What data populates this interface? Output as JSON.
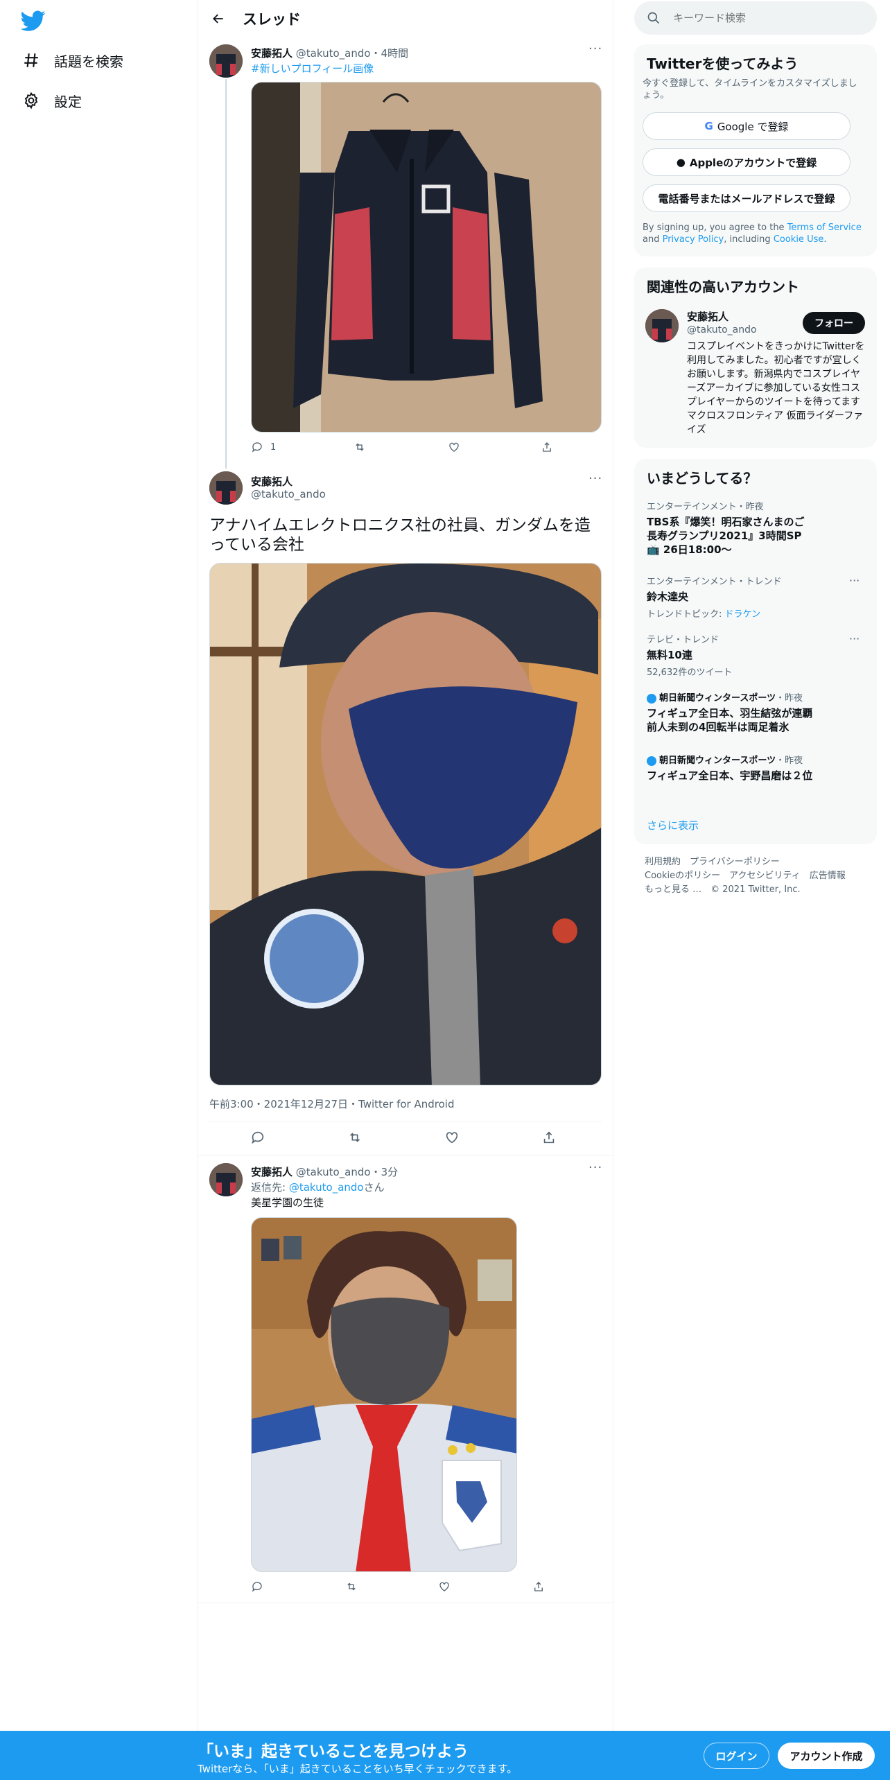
{
  "nav": {
    "logo": "twitter-bird-icon",
    "items": [
      {
        "icon": "hashtag-icon",
        "label": "話題を検索"
      },
      {
        "icon": "gear-icon",
        "label": "設定"
      }
    ]
  },
  "header": {
    "title": "スレッド"
  },
  "tweet1": {
    "name": "安藤拓人",
    "handle": "@takuto_ando",
    "time": "・4時間",
    "text": "#新しいプロフィール画像",
    "reply_count": "1"
  },
  "tweet2": {
    "name": "安藤拓人",
    "handle": "@takuto_ando",
    "text": "アナハイムエレクトロニクス社の社員、ガンダムを造っている会社",
    "meta": "午前3:00・2021年12月27日・Twitter for Android"
  },
  "tweet3": {
    "name": "安藤拓人",
    "handle": "@takuto_ando",
    "time": "・3分",
    "reply_prefix": "返信先: ",
    "reply_to": "@takuto_ando",
    "reply_suffix": "さん",
    "text": "美星学園の生徒"
  },
  "search": {
    "placeholder": "キーワード検索"
  },
  "signup_panel": {
    "title": "Twitterを使ってみよう",
    "subtitle": "今すぐ登録して、タイムラインをカスタマイズしましょう。",
    "google": "Google で登録",
    "apple": "Appleのアカウントで登録",
    "phone": "電話番号またはメールアドレスで登録",
    "legal_pre": "By signing up, you agree to the ",
    "tos": "Terms of Service",
    "legal_and": " and ",
    "privacy": "Privacy Policy",
    "legal_inc": ", including ",
    "cookie": "Cookie Use",
    "legal_end": "."
  },
  "related": {
    "title": "関連性の高いアカウント",
    "name": "安藤拓人",
    "handle": "@takuto_ando",
    "follow": "フォロー",
    "bio": "コスプレイベントをきっかけにTwitterを利用してみました。初心者ですが宜しくお願いします。新潟県内でコスプレイヤーズアーカイブに参加している女性コスプレイヤーからのツイートを待ってます マクロスフロンティア 仮面ライダーファイズ"
  },
  "trends": {
    "title": "いまどうしてる？",
    "items": [
      {
        "category": "エンターテインメント・昨夜",
        "title": "TBS系『爆笑！明石家さんまのご長寿グランプリ2021』3時間SP📺 26日18:00〜",
        "sub": ""
      },
      {
        "category": "エンターテインメント・トレンド",
        "title": "鈴木達央",
        "sub_pre": "トレンドトピック: ",
        "sub_link": "ドラケン"
      },
      {
        "category": "テレビ・トレンド",
        "title": "無料10連",
        "sub": "52,632件のツイート"
      },
      {
        "category_src": "朝日新聞ウィンタースポーツ",
        "category_time": "・昨夜",
        "title": "フィギュア全日本、羽生結弦が連覇　前人未到の4回転半は両足着氷"
      },
      {
        "category_src": "朝日新聞ウィンタースポーツ",
        "category_time": "・昨夜",
        "title": "フィギュア全日本、宇野昌磨は２位"
      }
    ],
    "show_more": "さらに表示"
  },
  "footer": {
    "line1": "利用規約　プライバシーポリシー",
    "line2": "Cookieのポリシー　アクセシビリティ　広告情報",
    "line3": "もっと見る …　© 2021 Twitter, Inc."
  },
  "bottom_bar": {
    "title": "「いま」起きていることを見つけよう",
    "subtitle": "Twitterなら、「いま」起きていることをいち早くチェックできます。",
    "login": "ログイン",
    "signup": "アカウント作成"
  },
  "colors": {
    "accent": "#1d9bf0",
    "text": "#0f1419",
    "muted": "#536471"
  }
}
